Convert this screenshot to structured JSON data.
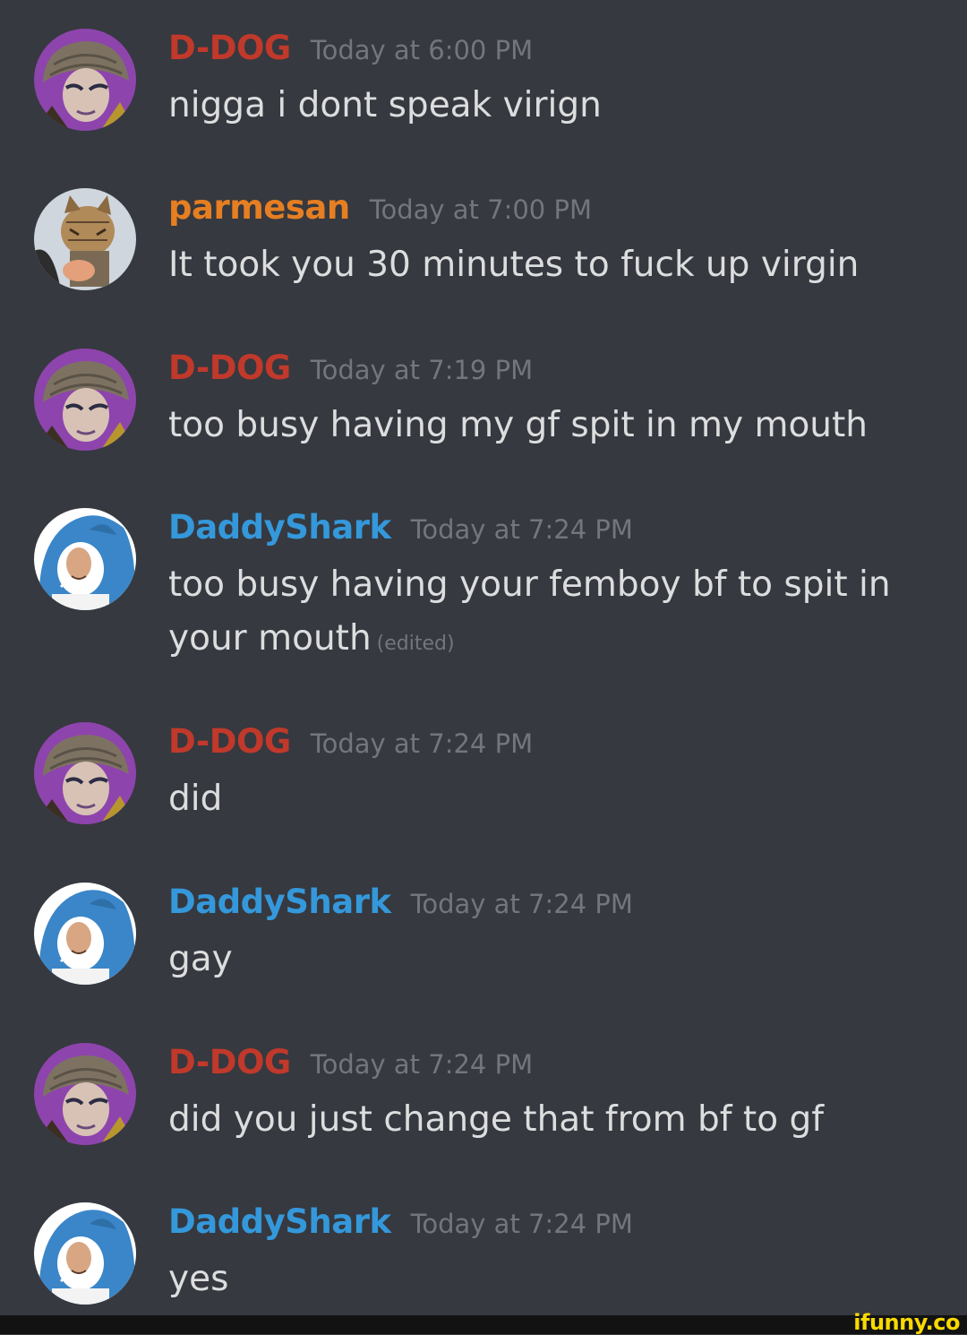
{
  "colors": {
    "background": "#36393f",
    "ddog_name": "#c0392b",
    "parmesan_name": "#e67e22",
    "daddyshark_name": "#3498db",
    "timestamp": "#72767d",
    "message_text": "#dcddde",
    "watermark": "#f9d900"
  },
  "messages": [
    {
      "author": "D-DOG",
      "time": "Today at 6:00 PM",
      "text": "nigga i dont speak virign",
      "avatar": "helmeted-character-avatar-icon"
    },
    {
      "author": "parmesan",
      "time": "Today at 7:00 PM",
      "text": "It took you 30 minutes to fuck up virgin",
      "avatar": "cat-avatar-icon"
    },
    {
      "author": "D-DOG",
      "time": "Today at 7:19 PM",
      "text": "too busy having my gf spit in my mouth",
      "avatar": "helmeted-character-avatar-icon"
    },
    {
      "author": "DaddyShark",
      "time": "Today at 7:24 PM",
      "text": "too busy having your femboy bf to spit in your mouth",
      "edited": "(edited)",
      "avatar": "shark-costume-avatar-icon"
    },
    {
      "author": "D-DOG",
      "time": "Today at 7:24 PM",
      "text": "did",
      "avatar": "helmeted-character-avatar-icon"
    },
    {
      "author": "DaddyShark",
      "time": "Today at 7:24 PM",
      "text": "gay",
      "avatar": "shark-costume-avatar-icon"
    },
    {
      "author": "D-DOG",
      "time": "Today at 7:24 PM",
      "text": "did you just change that from bf to gf",
      "avatar": "helmeted-character-avatar-icon"
    },
    {
      "author": "DaddyShark",
      "time": "Today at 7:24 PM",
      "text": "yes",
      "avatar": "shark-costume-avatar-icon"
    }
  ],
  "watermark": "ifunny.co"
}
